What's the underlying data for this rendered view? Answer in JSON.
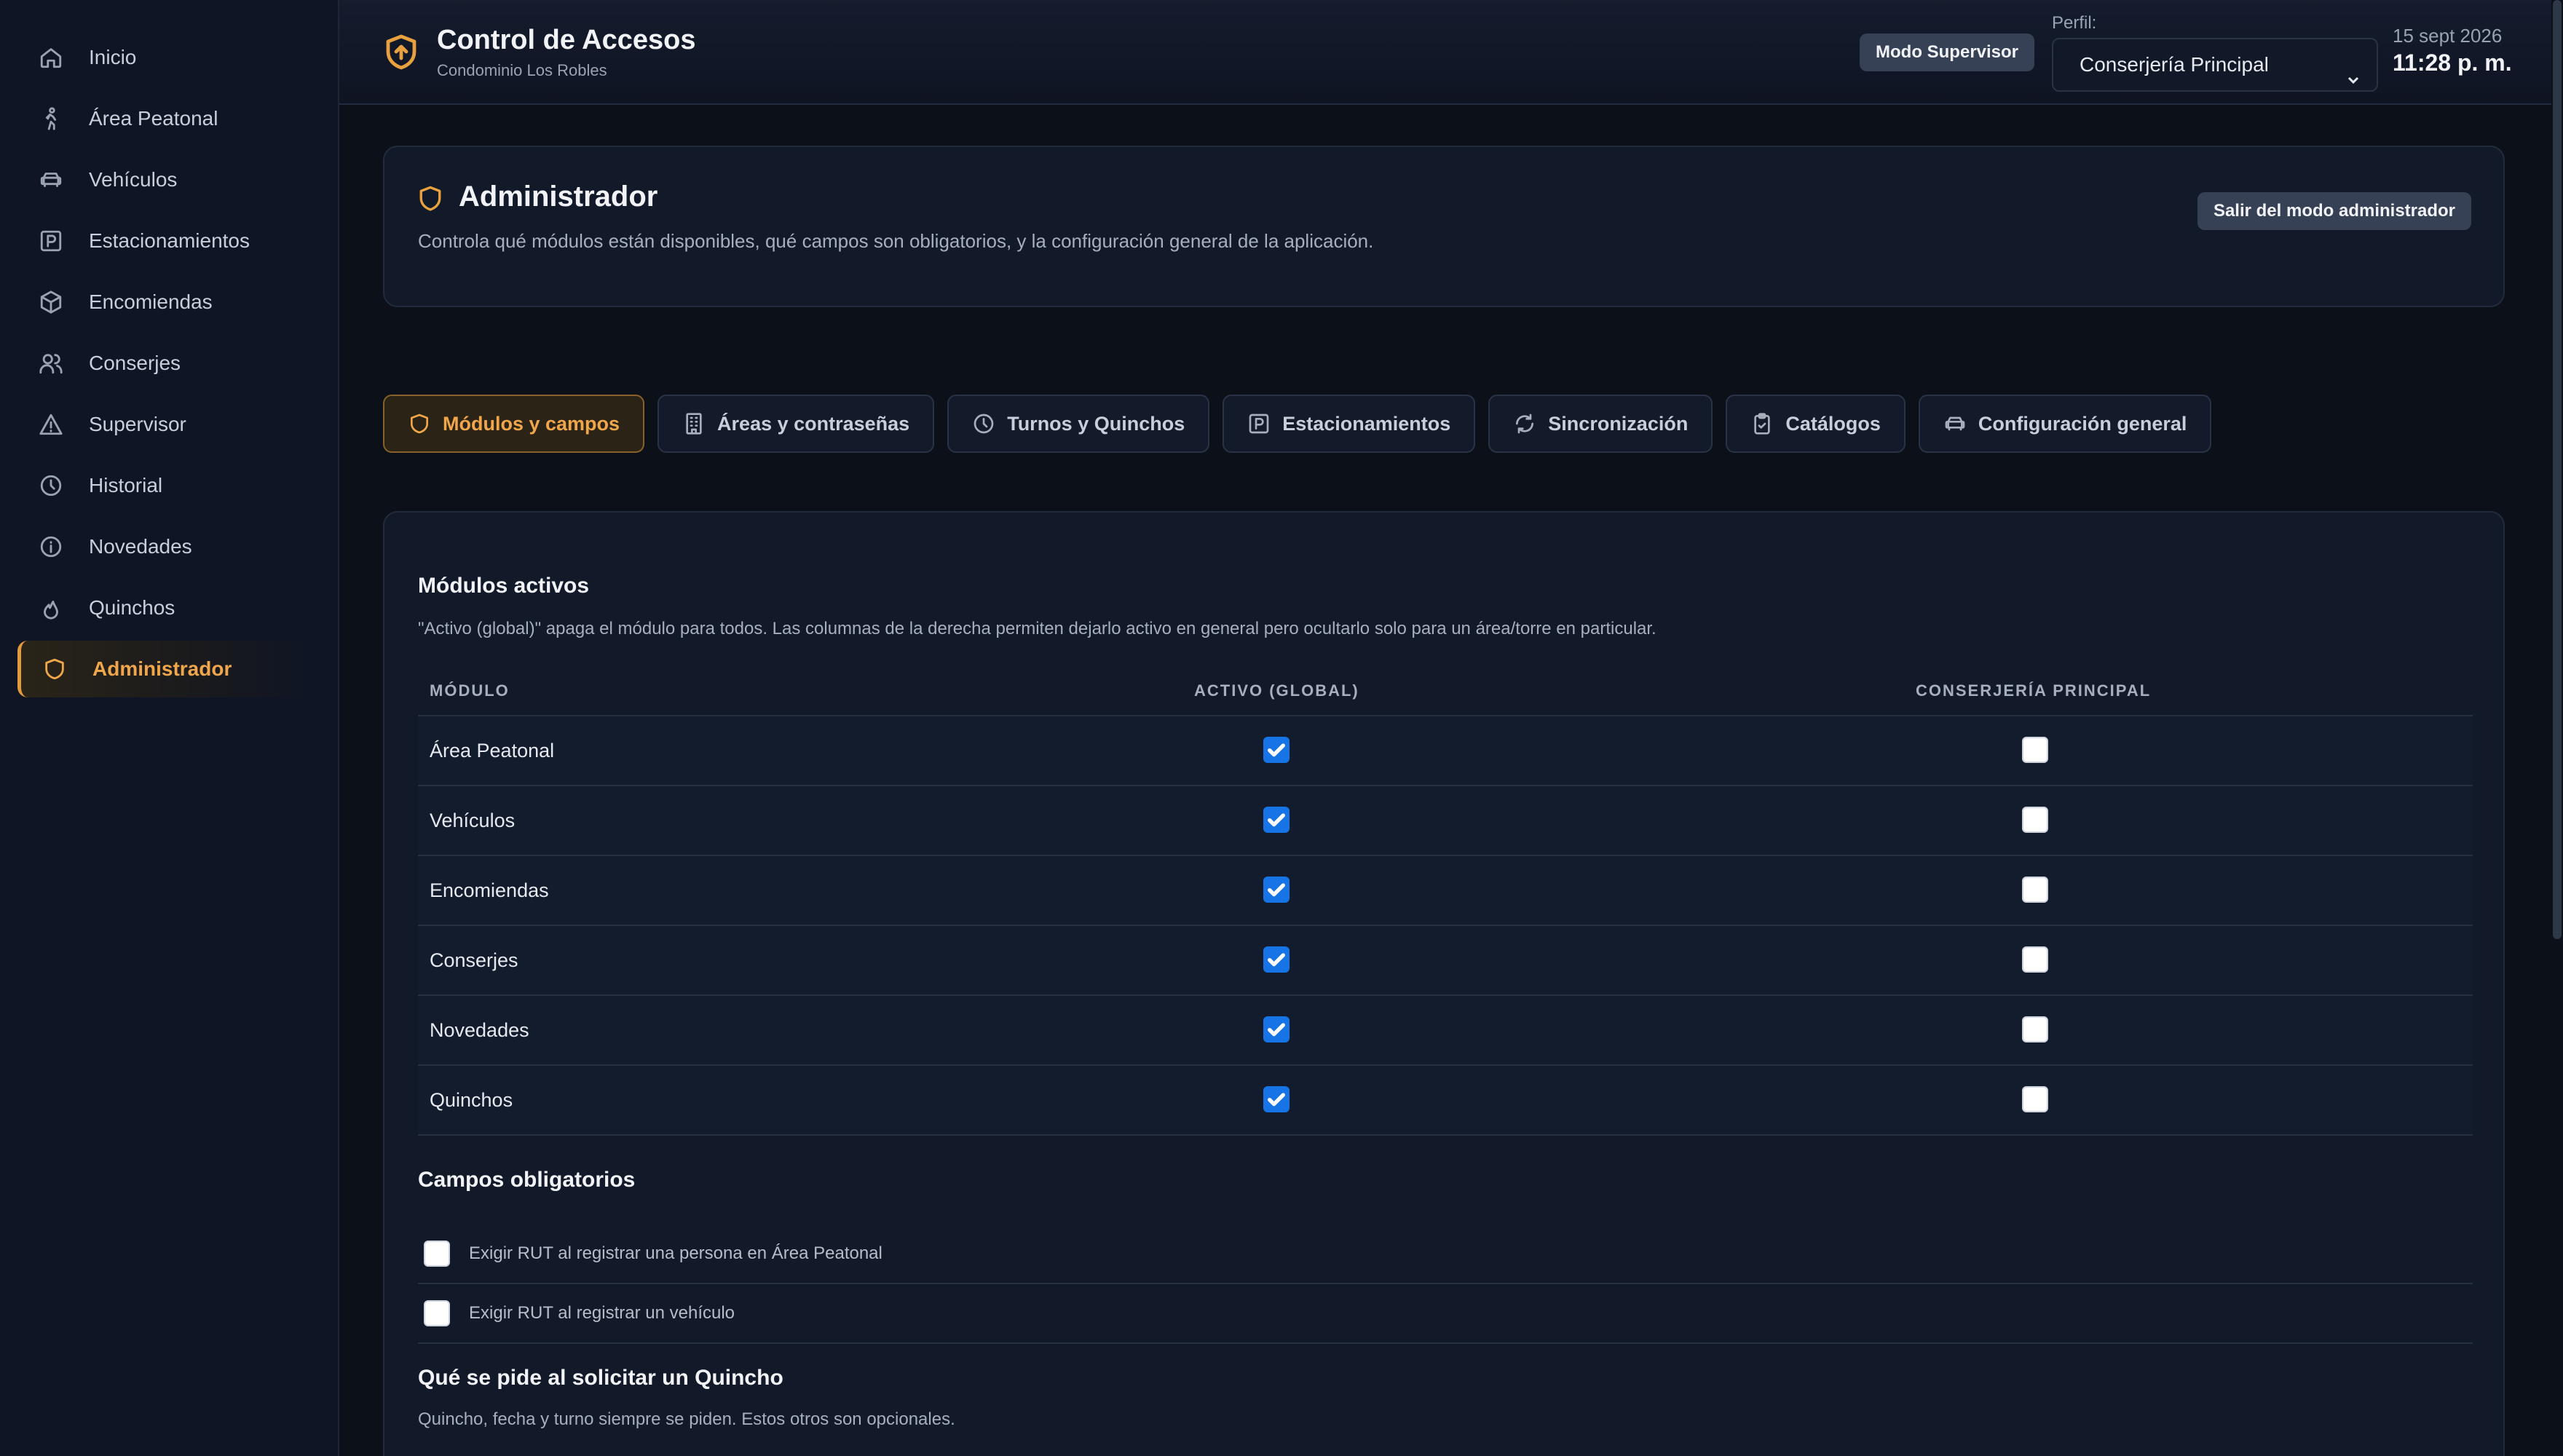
{
  "sidebar": {
    "items": [
      {
        "label": "Inicio",
        "icon": "home-icon"
      },
      {
        "label": "Área Peatonal",
        "icon": "walking-icon"
      },
      {
        "label": "Vehículos",
        "icon": "car-icon"
      },
      {
        "label": "Estacionamientos",
        "icon": "parking-icon"
      },
      {
        "label": "Encomiendas",
        "icon": "package-icon"
      },
      {
        "label": "Conserjes",
        "icon": "users-icon"
      },
      {
        "label": "Supervisor",
        "icon": "alert-icon"
      },
      {
        "label": "Historial",
        "icon": "clock-icon"
      },
      {
        "label": "Novedades",
        "icon": "info-icon"
      },
      {
        "label": "Quinchos",
        "icon": "flame-icon"
      },
      {
        "label": "Administrador",
        "icon": "shield-icon",
        "active": true
      }
    ]
  },
  "header": {
    "title": "Control de Accesos",
    "subtitle": "Condominio Los Robles",
    "mode_badge": "Modo Supervisor",
    "perfil_label": "Perfil:",
    "perfil_value": "Conserjería Principal",
    "date": "15 sept 2026",
    "time": "11:28 p. m."
  },
  "admin": {
    "title": "Administrador",
    "description": "Controla qué módulos están disponibles, qué campos son obligatorios, y la configuración general de la aplicación.",
    "exit_label": "Salir del modo administrador"
  },
  "tabs": [
    {
      "label": "Módulos y campos",
      "icon": "shield-icon",
      "active": true
    },
    {
      "label": "Áreas y contraseñas",
      "icon": "building-icon"
    },
    {
      "label": "Turnos y Quinchos",
      "icon": "clock-icon"
    },
    {
      "label": "Estacionamientos",
      "icon": "parking-icon"
    },
    {
      "label": "Sincronización",
      "icon": "sync-icon"
    },
    {
      "label": "Catálogos",
      "icon": "clipboard-icon"
    },
    {
      "label": "Configuración general",
      "icon": "car-icon"
    }
  ],
  "modules_section": {
    "title": "Módulos activos",
    "description": "\"Activo (global)\" apaga el módulo para todos. Las columnas de la derecha permiten dejarlo activo en general pero ocultarlo solo para un área/torre en particular.",
    "columns": [
      "MÓDULO",
      "ACTIVO (GLOBAL)",
      "CONSERJERÍA PRINCIPAL"
    ],
    "rows": [
      {
        "name": "Área Peatonal",
        "global": true,
        "principal": false
      },
      {
        "name": "Vehículos",
        "global": true,
        "principal": false
      },
      {
        "name": "Encomiendas",
        "global": true,
        "principal": false
      },
      {
        "name": "Conserjes",
        "global": true,
        "principal": false
      },
      {
        "name": "Novedades",
        "global": true,
        "principal": false
      },
      {
        "name": "Quinchos",
        "global": true,
        "principal": false
      }
    ]
  },
  "required_section": {
    "title": "Campos obligatorios",
    "items": [
      {
        "label": "Exigir RUT al registrar una persona en Área Peatonal",
        "checked": false
      },
      {
        "label": "Exigir RUT al registrar un vehículo",
        "checked": false
      }
    ]
  },
  "quincho_section": {
    "title": "Qué se pide al solicitar un Quincho",
    "description": "Quincho, fecha y turno siempre se piden. Estos otros son opcionales."
  },
  "colors": {
    "accent": "#e9a13f",
    "checkbox": "#1674e6",
    "background": "#0c1019"
  }
}
